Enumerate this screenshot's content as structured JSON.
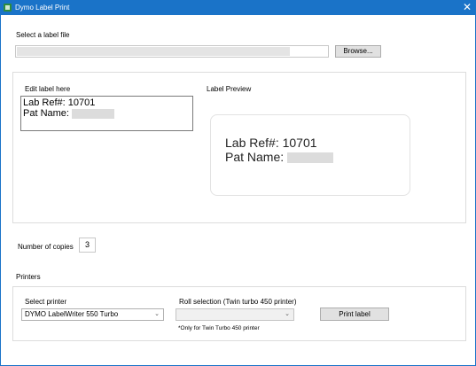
{
  "window": {
    "title": "Dymo Label Print",
    "close_glyph": "✕"
  },
  "file": {
    "label": "Select a label file",
    "path_value": "",
    "browse_label": "Browse..."
  },
  "editor": {
    "label": "Edit label here",
    "line1": "Lab Ref#: 10701",
    "line2_prefix": "Pat Name:"
  },
  "preview": {
    "label": "Label Preview",
    "line1": "Lab Ref#: 10701",
    "line2_prefix": "Pat Name:"
  },
  "copies": {
    "label": "Number of copies",
    "value": "3"
  },
  "printers": {
    "section_label": "Printers",
    "select_printer_label": "Select printer",
    "selected_printer": "DYMO LabelWriter 550 Turbo",
    "roll_label": "Roll selection (Twin turbo 450 printer)",
    "roll_selected": "",
    "roll_note": "*Only for Twin Turbo 450 printer",
    "print_button": "Print label"
  },
  "icons": {
    "app": "dymo-app-icon",
    "close": "close-icon",
    "dropdown": "chevron-down-icon"
  },
  "colors": {
    "titlebar": "#1a73c8",
    "button": "#e1e1e1"
  }
}
